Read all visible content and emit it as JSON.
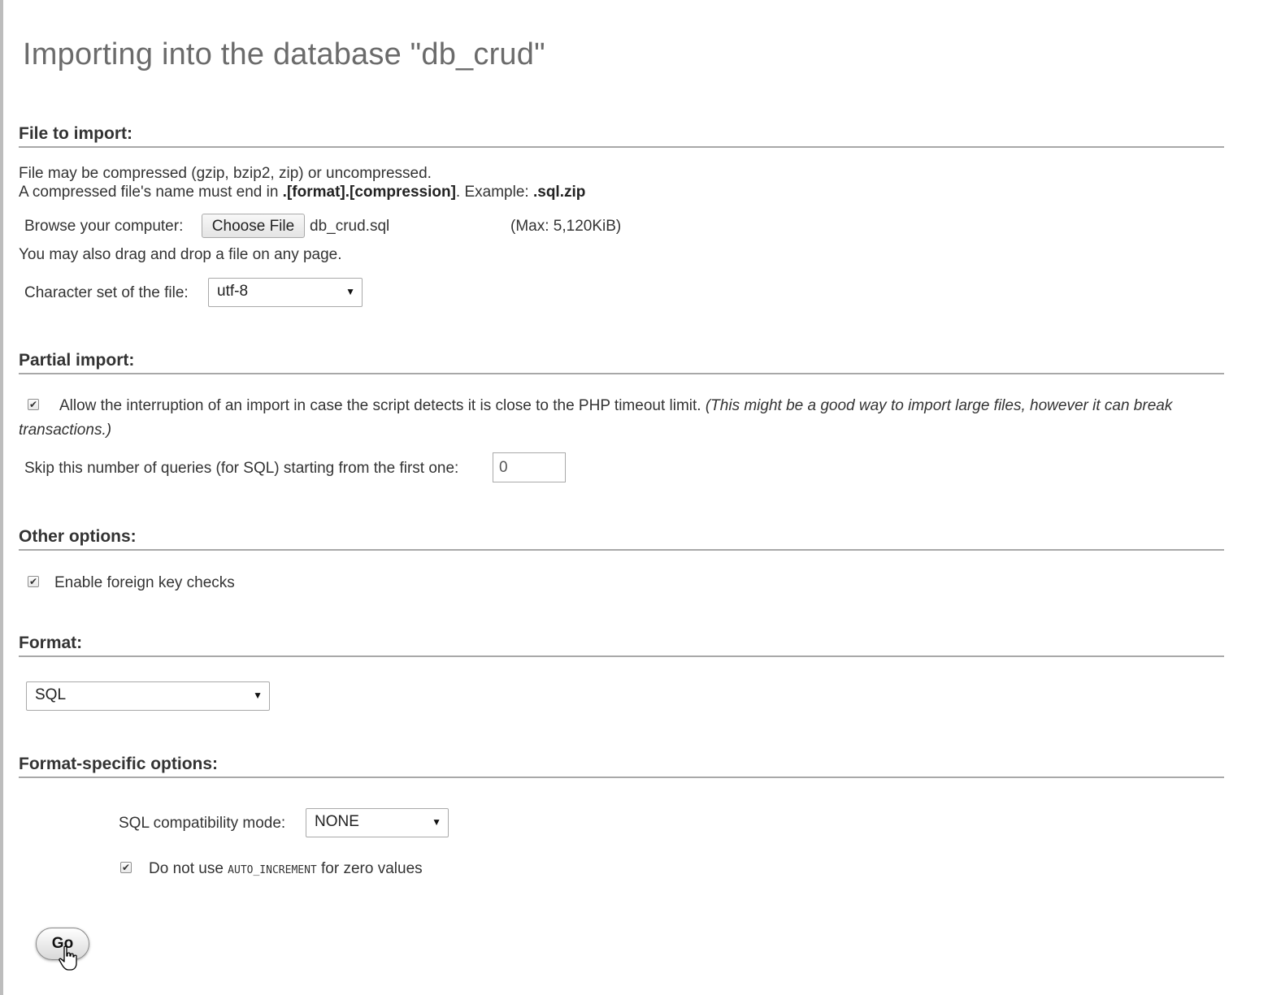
{
  "page": {
    "title": "Importing into the database \"db_crud\""
  },
  "file_section": {
    "heading": "File to import:",
    "line1": "File may be compressed (gzip, bzip2, zip) or uncompressed.",
    "line2_prefix": "A compressed file's name must end in ",
    "line2_format": ".[format].[compression]",
    "line2_middle": ". Example: ",
    "line2_example": ".sql.zip",
    "browse_label": "Browse your computer:",
    "choose_button": "Choose File",
    "chosen_file": "db_crud.sql",
    "max_size": "(Max: 5,120KiB)",
    "drag_drop": "You may also drag and drop a file on any page.",
    "charset_label": "Character set of the file:",
    "charset_value": "utf-8"
  },
  "partial_section": {
    "heading": "Partial import:",
    "allow_interrupt_checked": true,
    "allow_interrupt_label": "Allow the interruption of an import in case the script detects it is close to the PHP timeout limit.",
    "allow_interrupt_note_line1": "(This might be a good way to import large files, however it can break",
    "allow_interrupt_note_line2": "transactions.)",
    "skip_label": "Skip this number of queries (for SQL) starting from the first one:",
    "skip_value": "0"
  },
  "other_section": {
    "heading": "Other options:",
    "foreign_key_checked": true,
    "foreign_key_label": "Enable foreign key checks"
  },
  "format_section": {
    "heading": "Format:",
    "format_value": "SQL"
  },
  "format_specific_section": {
    "heading": "Format-specific options:",
    "compat_label": "SQL compatibility mode:",
    "compat_value": "NONE",
    "auto_inc_checked": true,
    "auto_inc_prefix": "Do not use ",
    "auto_inc_code": "AUTO_INCREMENT",
    "auto_inc_suffix": " for zero values"
  },
  "actions": {
    "go_label": "Go"
  },
  "icons": {
    "checkmark": "check-icon",
    "dropdown": "triangle-down-icon",
    "cursor": "hand-pointer-icon"
  }
}
